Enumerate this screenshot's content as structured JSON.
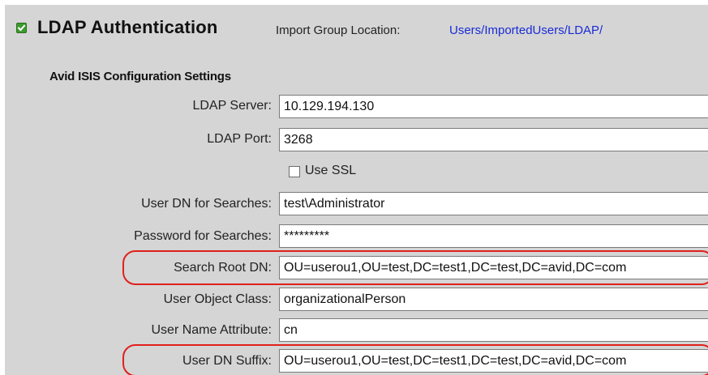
{
  "header": {
    "title": "LDAP Authentication",
    "import_label": "Import Group Location:",
    "import_value": "Users/ImportedUsers/LDAP/",
    "enabled_icon": "checkbox-checked-icon",
    "enabled": true
  },
  "section": {
    "title": "Avid ISIS Configuration Settings"
  },
  "fields": {
    "ldap_server": {
      "label": "LDAP Server:",
      "value": "10.129.194.130"
    },
    "ldap_port": {
      "label": "LDAP Port:",
      "value": "3268"
    },
    "use_ssl": {
      "label": "Use SSL",
      "checked": false
    },
    "user_dn": {
      "label": "User DN for Searches:",
      "value": "test\\Administrator"
    },
    "password": {
      "label": "Password for Searches:",
      "value": "*********"
    },
    "search_root_dn": {
      "label": "Search Root DN:",
      "value": "OU=userou1,OU=test,DC=test1,DC=test,DC=avid,DC=com"
    },
    "user_object_class": {
      "label": "User Object Class:",
      "value": "organizationalPerson"
    },
    "user_name_attribute": {
      "label": "User Name Attribute:",
      "value": "cn"
    },
    "user_dn_suffix": {
      "label": "User DN Suffix:",
      "value": "OU=userou1,OU=test,DC=test1,DC=test,DC=avid,DC=com"
    }
  },
  "colors": {
    "panel": "#d5d5d5",
    "link": "#1a2bd6",
    "highlight": "#e0201c",
    "check_green": "#3c9a2e"
  }
}
